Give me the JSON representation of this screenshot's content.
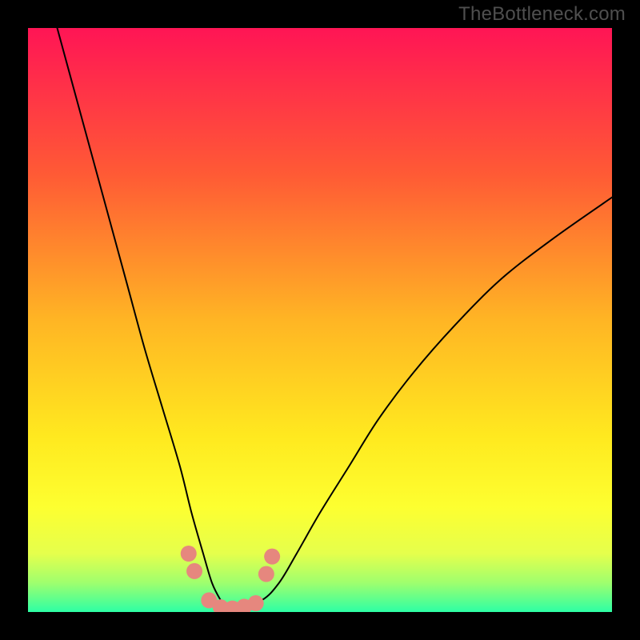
{
  "watermark": "TheBottleneck.com",
  "chart_data": {
    "type": "line",
    "title": "",
    "xlabel": "",
    "ylabel": "",
    "xlim": [
      0,
      100
    ],
    "ylim": [
      0,
      100
    ],
    "background_gradient_stops": [
      {
        "pos": 0.0,
        "color": "#ff1555"
      },
      {
        "pos": 0.25,
        "color": "#ff5a35"
      },
      {
        "pos": 0.5,
        "color": "#ffb524"
      },
      {
        "pos": 0.7,
        "color": "#ffe91f"
      },
      {
        "pos": 0.82,
        "color": "#fdff30"
      },
      {
        "pos": 0.9,
        "color": "#e5ff4c"
      },
      {
        "pos": 0.95,
        "color": "#9fff6e"
      },
      {
        "pos": 1.0,
        "color": "#2dffa5"
      }
    ],
    "series": [
      {
        "name": "main-curve",
        "color": "#000000",
        "linewidth": 2,
        "x": [
          5,
          8,
          11,
          14,
          17,
          20,
          23,
          26,
          28,
          30,
          31.5,
          33,
          34,
          34.8,
          35.6,
          40,
          43,
          46,
          50,
          55,
          60,
          66,
          73,
          81,
          90,
          100
        ],
        "y": [
          100,
          89,
          78,
          67,
          56,
          45,
          35,
          25,
          17,
          10,
          5,
          2,
          0.8,
          0.3,
          0.8,
          2,
          5,
          10,
          17,
          25,
          33,
          41,
          49,
          57,
          64,
          71
        ]
      },
      {
        "name": "trough-markers",
        "type": "scatter",
        "color": "#e6877e",
        "marker_size": 10,
        "x": [
          27.5,
          28.5,
          31,
          33,
          35,
          37,
          39,
          40.8,
          41.8
        ],
        "y": [
          10,
          7,
          2,
          0.8,
          0.6,
          0.9,
          1.5,
          6.5,
          9.5
        ]
      }
    ]
  }
}
